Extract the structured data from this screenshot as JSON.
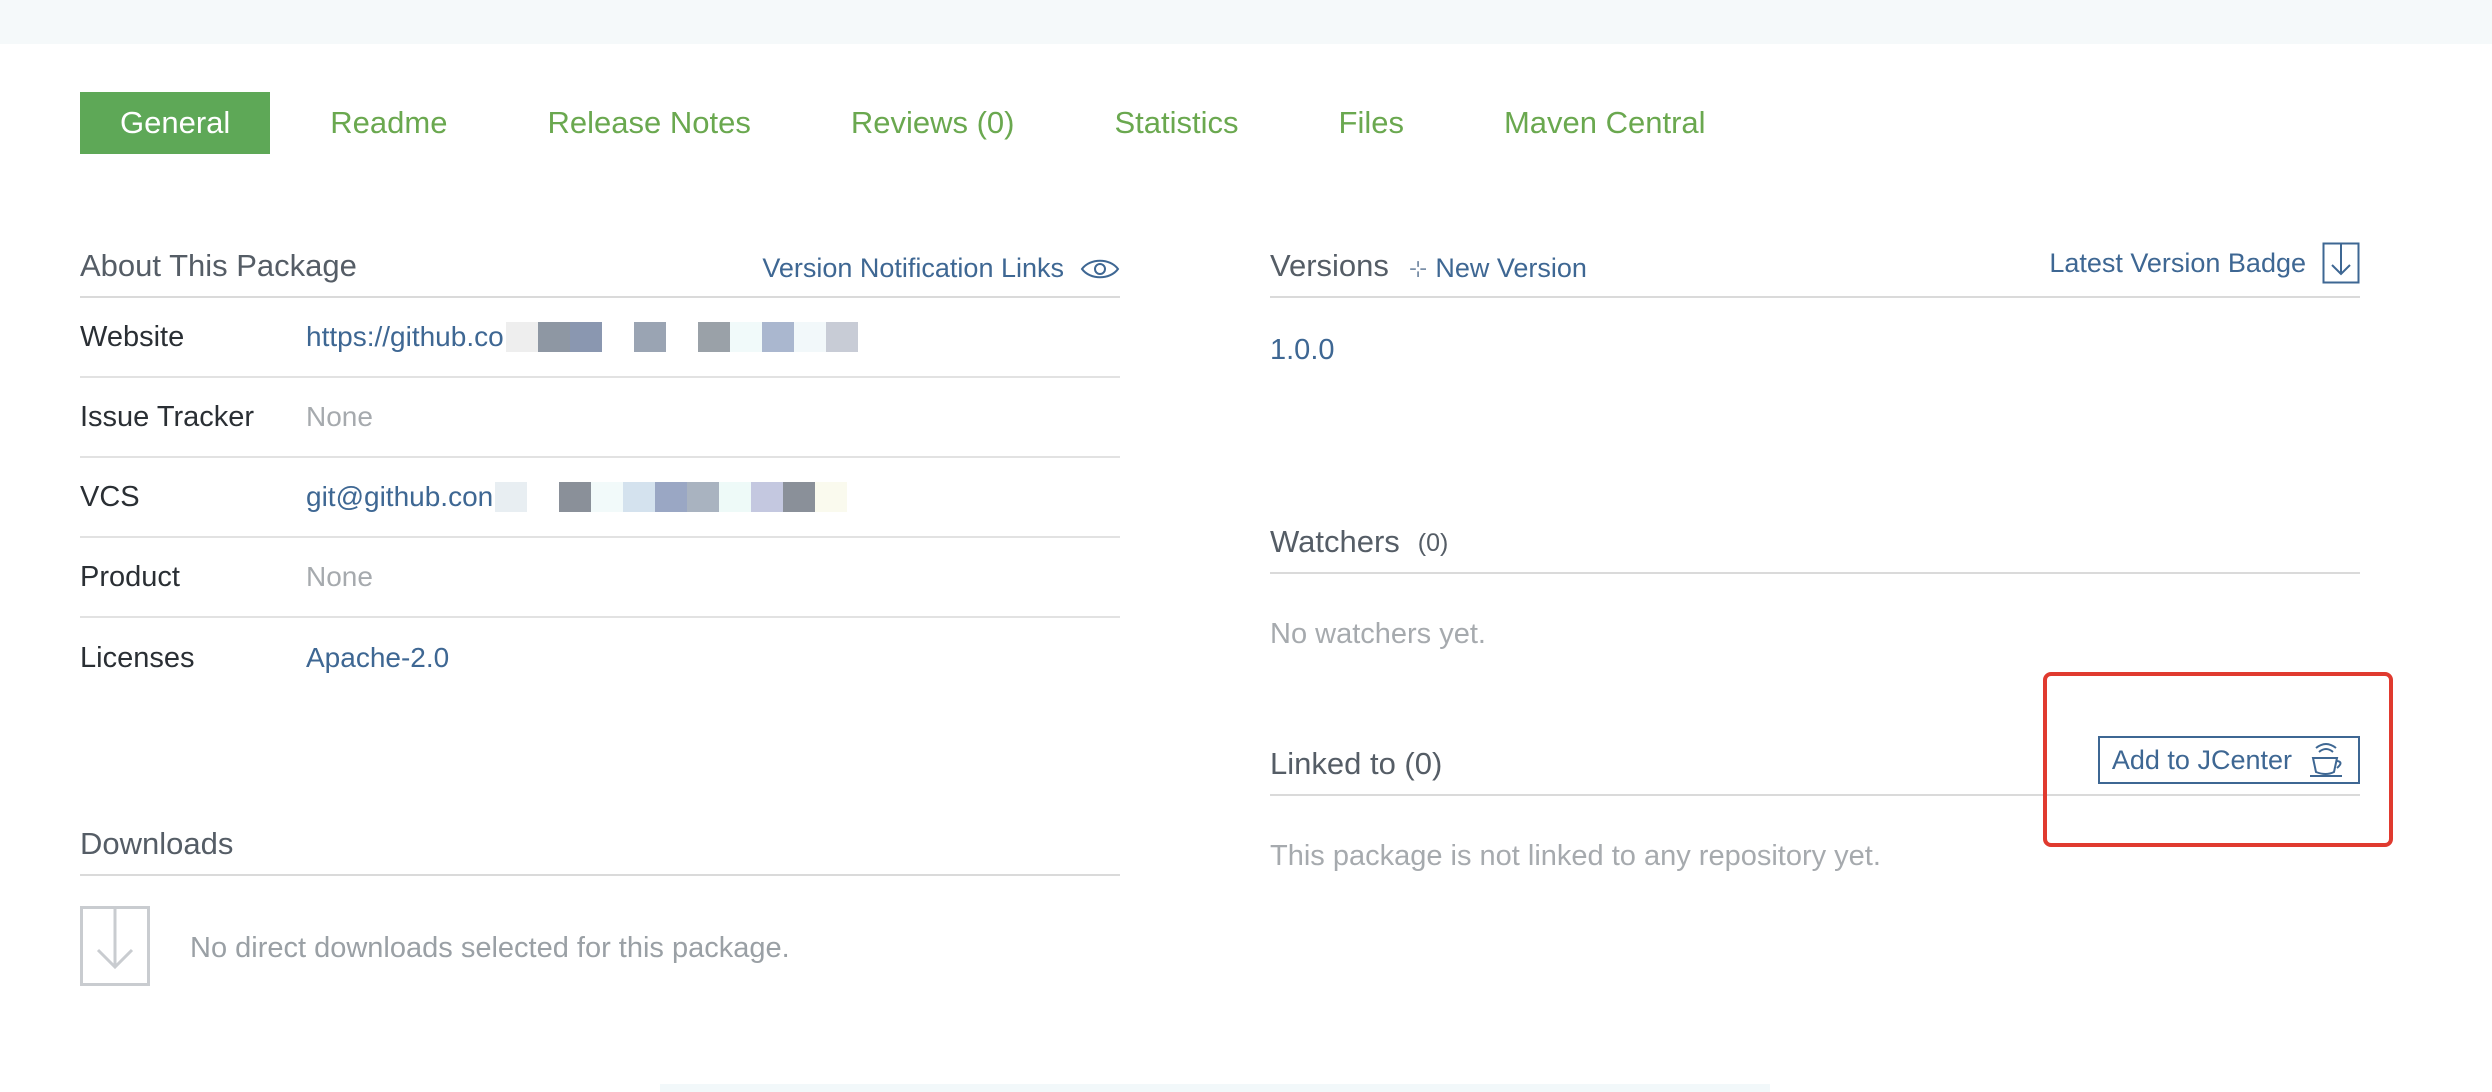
{
  "tabs": [
    {
      "label": "General",
      "active": true
    },
    {
      "label": "Readme"
    },
    {
      "label": "Release Notes"
    },
    {
      "label": "Reviews (0)"
    },
    {
      "label": "Statistics"
    },
    {
      "label": "Files"
    },
    {
      "label": "Maven Central"
    }
  ],
  "about": {
    "title": "About This Package",
    "notification_link": "Version Notification Links",
    "rows": [
      {
        "label": "Website",
        "value": "https://github.co"
      },
      {
        "label": "Issue Tracker",
        "value": "None"
      },
      {
        "label": "VCS",
        "value": "git@github.con"
      },
      {
        "label": "Product",
        "value": "None"
      },
      {
        "label": "Licenses",
        "value": "Apache-2.0"
      }
    ]
  },
  "downloads": {
    "title": "Downloads",
    "empty_message": "No direct downloads selected for this package."
  },
  "versions": {
    "title": "Versions",
    "new_version": "New Version",
    "badge_link": "Latest Version Badge",
    "items": [
      "1.0.0"
    ]
  },
  "watchers": {
    "title": "Watchers",
    "count": "(0)",
    "empty_message": "No watchers yet."
  },
  "linked": {
    "title": "Linked to (0)",
    "add_button": "Add to JCenter",
    "empty_message": "This package is not linked to any repository yet."
  },
  "colors": {
    "brand_green": "#5ea857",
    "link_blue": "#3e6793",
    "highlight_red": "#e03a2f"
  }
}
